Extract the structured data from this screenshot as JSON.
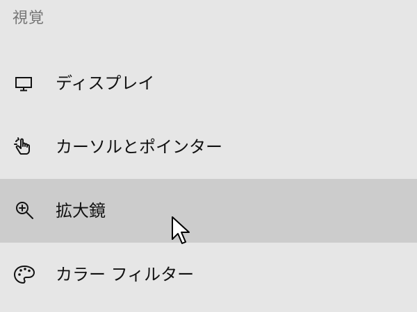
{
  "section": {
    "title": "視覚"
  },
  "nav": {
    "items": [
      {
        "label": "ディスプレイ",
        "icon": "monitor-icon",
        "selected": false
      },
      {
        "label": "カーソルとポインター",
        "icon": "hand-pointer-icon",
        "selected": false
      },
      {
        "label": "拡大鏡",
        "icon": "magnifier-zoom-in-icon",
        "selected": true
      },
      {
        "label": "カラー フィルター",
        "icon": "color-palette-icon",
        "selected": false
      }
    ]
  },
  "colors": {
    "background": "#e6e6e6",
    "selected_background": "#cccccc",
    "header_text": "#757575",
    "item_text": "#111111"
  },
  "mouse_cursor": {
    "icon": "arrow-pointer-icon"
  }
}
